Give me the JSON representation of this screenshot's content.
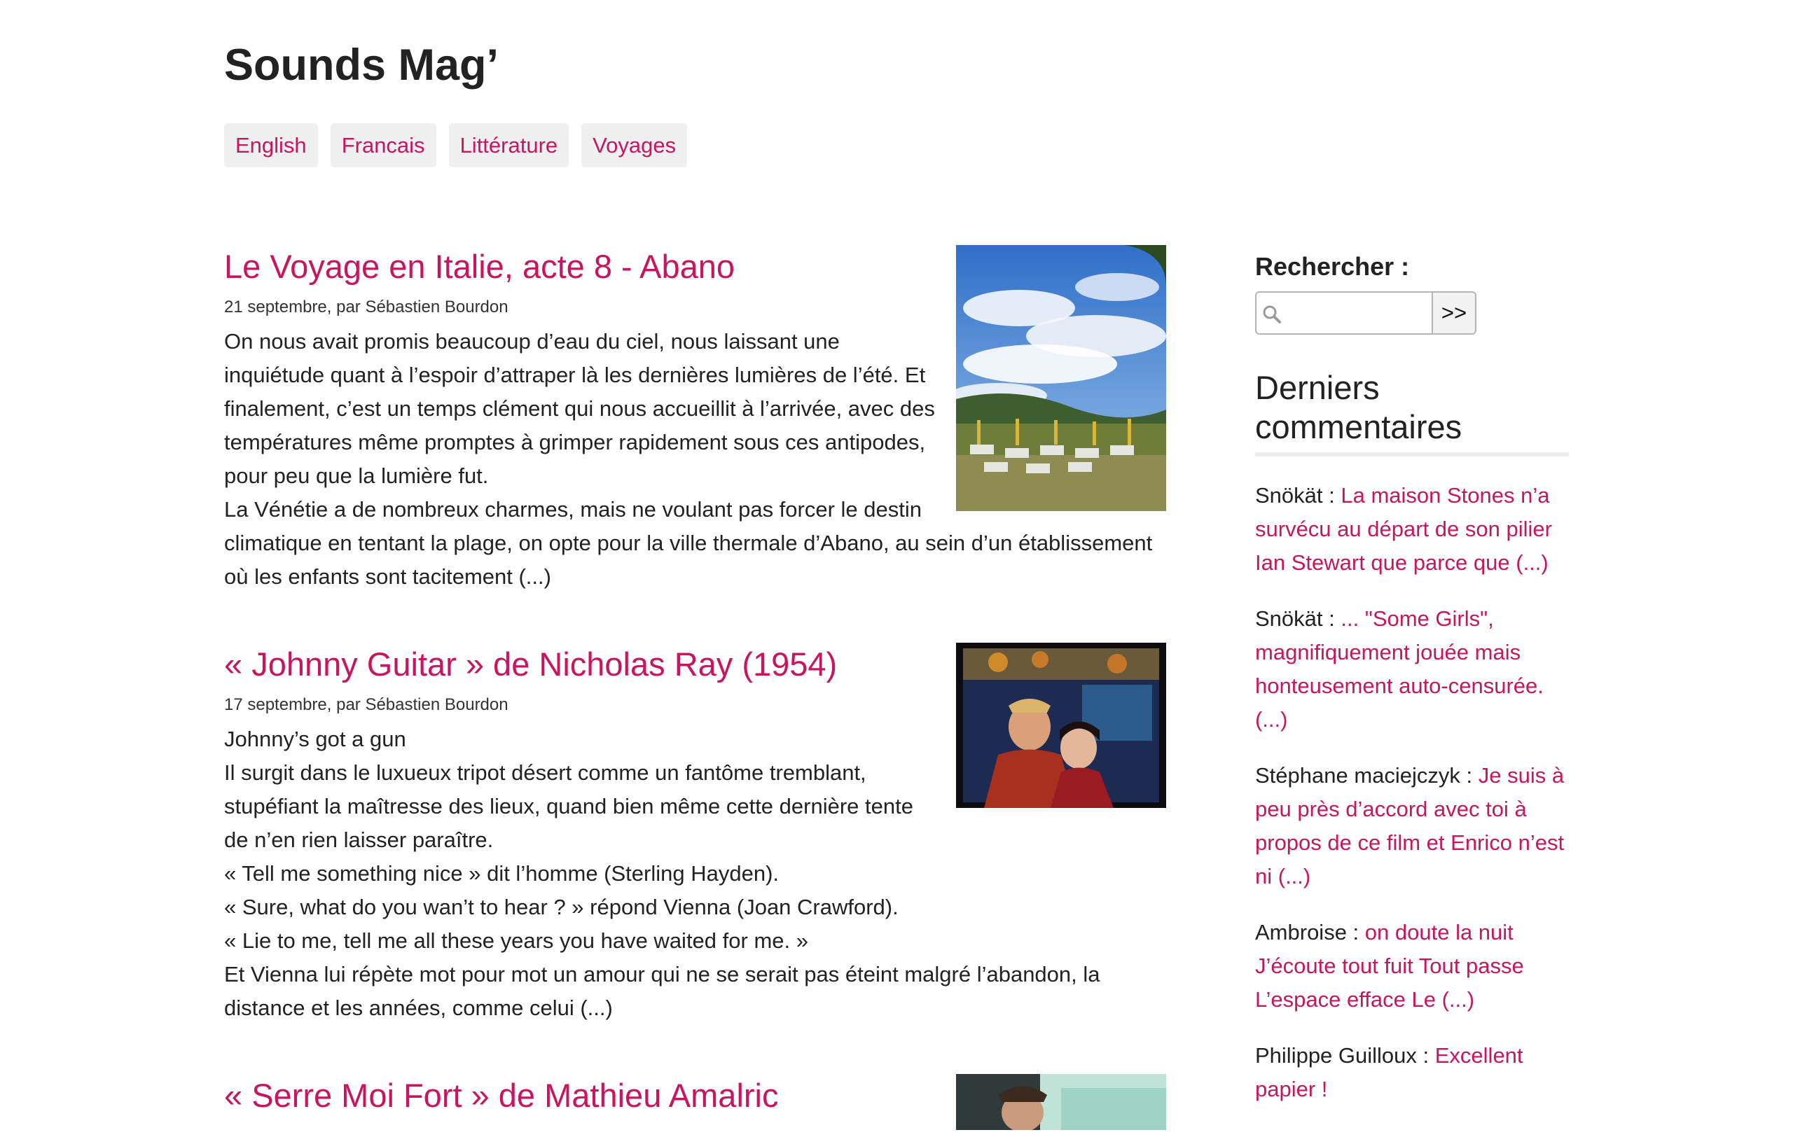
{
  "site": {
    "title": "Sounds Mag’"
  },
  "nav": [
    {
      "label": "English"
    },
    {
      "label": "Francais"
    },
    {
      "label": "Littérature"
    },
    {
      "label": "Voyages"
    }
  ],
  "articles": [
    {
      "title": "Le Voyage en Italie, acte 8 - Abano",
      "meta": "21 septembre, par Sébastien Bourdon",
      "paragraphs": [
        "On nous avait promis beaucoup d’eau du ciel, nous laissant une inquiétude quant à l’espoir d’attraper là les dernières lumières de l’été. Et finalement, c’est un temps clément qui nous accueillit à l’arrivée, avec des températures même promptes à grimper rapidement sous ces antipodes, pour peu que la lumière fut.",
        "La Vénétie a de nombreux charmes, mais ne voulant pas forcer le destin climatique en tentant la plage, on opte pour la ville thermale d’Abano, au sein d’un établissement où les enfants sont tacitement (...)"
      ],
      "thumb": "sky-meadow-photo"
    },
    {
      "title": "« Johnny Guitar » de Nicholas Ray (1954)",
      "meta": "17 septembre, par Sébastien Bourdon",
      "paragraphs": [
        "Johnny’s got a gun",
        "Il surgit dans le luxueux tripot désert comme un fantôme tremblant, stupéfiant la maîtresse des lieux, quand bien même cette dernière tente de n’en rien laisser paraître.",
        "« Tell me something nice » dit l’homme (Sterling Hayden).",
        "« Sure, what do you wan’t to hear ? » répond Vienna (Joan Crawford).",
        "« Lie to me, tell me all these years you have waited for me. »",
        "Et Vienna lui répète mot pour mot un amour qui ne se serait pas éteint malgré l’abandon, la distance et les années, comme celui (...)"
      ],
      "thumb": "film-still-photo"
    },
    {
      "title": "« Serre Moi Fort » de Mathieu Amalric",
      "meta": "",
      "paragraphs": [],
      "thumb": "car-scene-photo"
    }
  ],
  "sidebar": {
    "search_label": "Rechercher :",
    "search_placeholder": "",
    "search_button": ">>",
    "comments_title": "Derniers commentaires",
    "comments": [
      {
        "author": "Snökät : ",
        "excerpt": "La maison Stones n’a survécu au départ de son pilier Ian Stewart que parce que (...)"
      },
      {
        "author": "Snökät : ",
        "excerpt": "... \"Some Girls\", magnifiquement jouée mais honteusement auto-censurée. (...)"
      },
      {
        "author": "Stéphane maciejczyk  : ",
        "excerpt": "Je suis à peu près d’accord avec toi à propos de ce film et Enrico n’est ni (...)"
      },
      {
        "author": "Ambroise : ",
        "excerpt": "on doute la nuit J’écoute tout fuit Tout passe L’espace efface Le (...)"
      },
      {
        "author": "Philippe Guilloux : ",
        "excerpt": "Excellent papier !"
      }
    ]
  },
  "colors": {
    "accent": "#c8155f",
    "text": "#222222",
    "tag_bg": "#f0f0f0"
  }
}
